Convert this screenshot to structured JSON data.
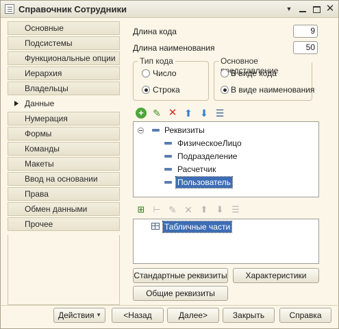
{
  "window": {
    "title": "Справочник Сотрудники"
  },
  "sidebar": {
    "items": [
      {
        "label": "Основные"
      },
      {
        "label": "Подсистемы"
      },
      {
        "label": "Функциональные опции"
      },
      {
        "label": "Иерархия"
      },
      {
        "label": "Владельцы"
      },
      {
        "label": "Данные",
        "active": true
      },
      {
        "label": "Нумерация"
      },
      {
        "label": "Формы"
      },
      {
        "label": "Команды"
      },
      {
        "label": "Макеты"
      },
      {
        "label": "Ввод на основании"
      },
      {
        "label": "Права"
      },
      {
        "label": "Обмен данными"
      },
      {
        "label": "Прочее"
      }
    ]
  },
  "fields": {
    "code_length_label": "Длина кода",
    "code_length_value": "9",
    "name_length_label": "Длина наименования",
    "name_length_value": "50"
  },
  "code_type": {
    "title": "Тип кода",
    "options": [
      "Число",
      "Строка"
    ],
    "selected": "Строка"
  },
  "main_representation": {
    "title": "Основное представление",
    "options": [
      "В виде кода",
      "В виде наименования"
    ],
    "selected": "В виде наименования"
  },
  "attributes": {
    "root": "Реквизиты",
    "items": [
      "ФизическоеЛицо",
      "Подразделение",
      "Расчетчик",
      "Пользователь"
    ],
    "selected": "Пользователь"
  },
  "tabular": {
    "items": [
      "Табличные части"
    ]
  },
  "buttons": {
    "standard_attributes": "Стандартные реквизиты",
    "characteristics": "Характеристики",
    "common_attributes": "Общие реквизиты",
    "actions": "Действия",
    "back": "<Назад",
    "next": "Далее>",
    "close": "Закрыть",
    "help": "Справка"
  }
}
